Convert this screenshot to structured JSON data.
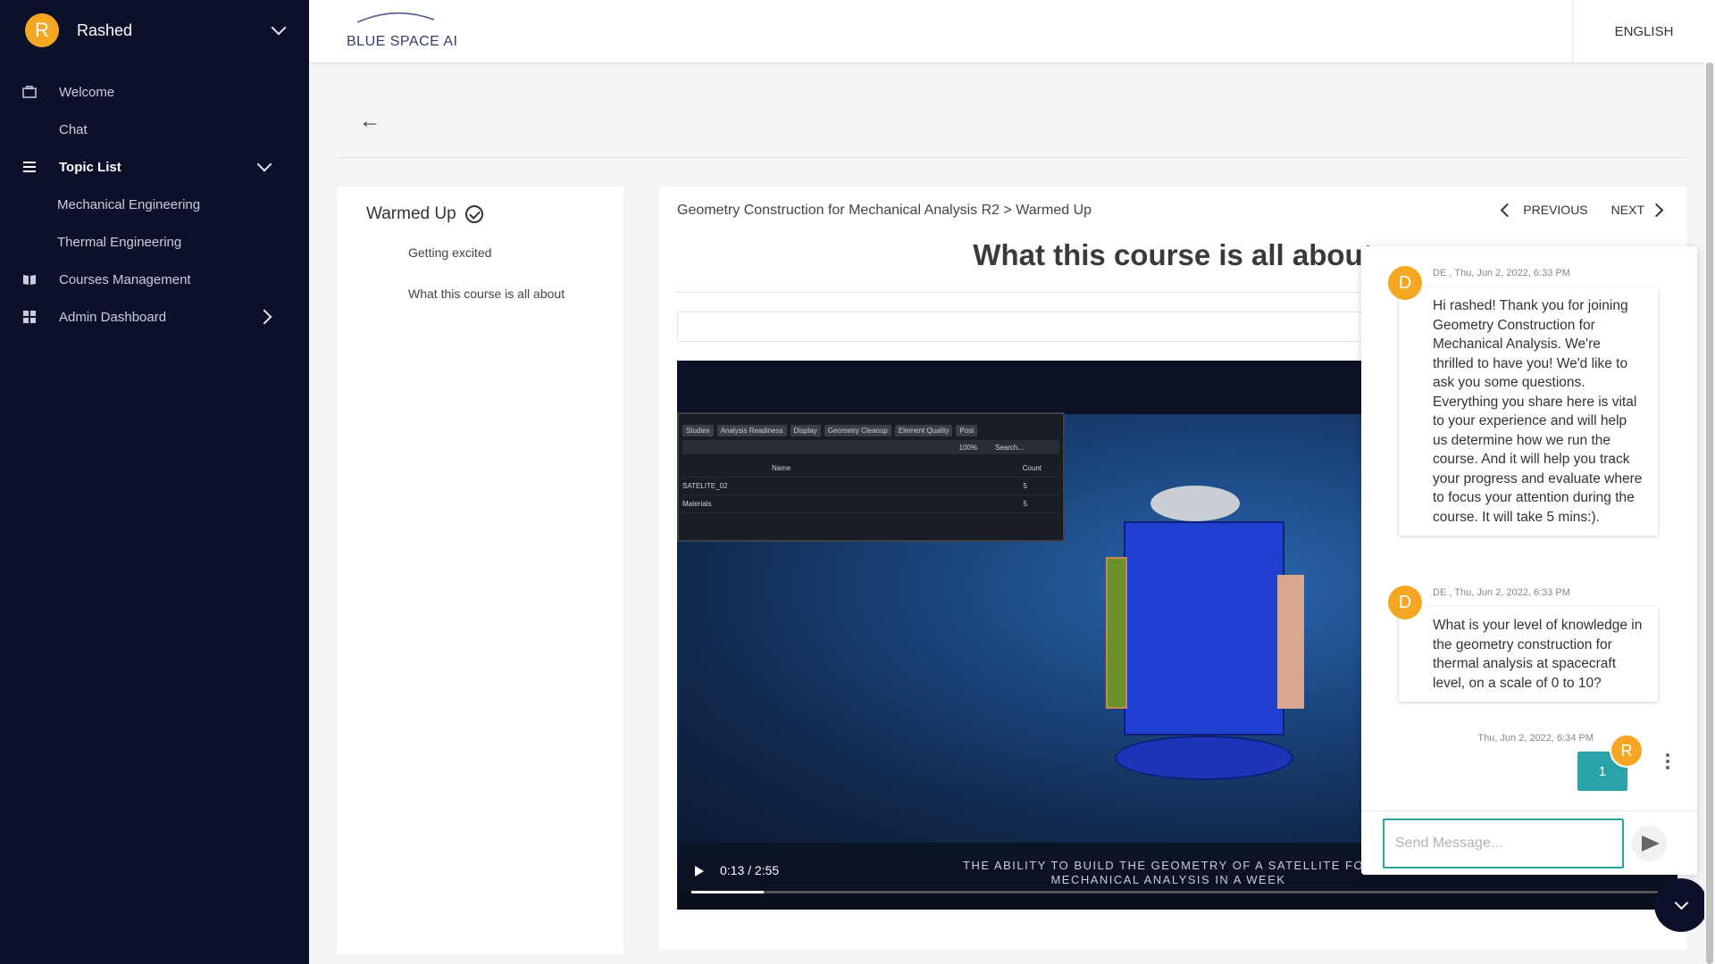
{
  "sidebar": {
    "user": {
      "initial": "R",
      "name": "Rashed"
    },
    "items": [
      {
        "label": "Welcome",
        "icon": "briefcase-icon"
      },
      {
        "label": "Chat"
      },
      {
        "label": "Topic List",
        "icon": "menu-icon"
      },
      {
        "label": "Mechanical Engineering"
      },
      {
        "label": "Thermal Engineering"
      },
      {
        "label": "Courses Management",
        "icon": "book-icon"
      },
      {
        "label": "Admin Dashboard",
        "icon": "dashboard-icon"
      }
    ]
  },
  "header": {
    "logo_text": "BLUE SPACE AI",
    "language": "ENGLISH"
  },
  "topic": {
    "title": "Warmed Up",
    "lessons": [
      "Getting excited",
      "What this course is all about"
    ]
  },
  "content": {
    "breadcrumb": "Geometry Construction for Mechanical Analysis R2 > Warmed Up",
    "previous": "PREVIOUS",
    "next": "NEXT",
    "title": "What this course is all about"
  },
  "video": {
    "tabs": [
      "Studies",
      "Analysis Readiness",
      "Display",
      "Geometry Cleanup",
      "Element Quality",
      "Post"
    ],
    "grid": {
      "header_name": "Name",
      "header_count": "Count",
      "rows": [
        {
          "name": "SATELITE_02",
          "count": "5"
        },
        {
          "name": "Materials",
          "count": "5"
        }
      ],
      "zoom": "100%",
      "search": "Search..."
    },
    "time": "0:13 / 2:55",
    "progress": 0.074,
    "caption": "THE ABILITY TO BUILD THE GEOMETRY OF A SATELLITE FOR MECHANICAL ANALYSIS IN A WEEK"
  },
  "chat": {
    "messages": [
      {
        "sender_initial": "D",
        "meta": "DE , Thu, Jun 2, 2022, 6:33 PM",
        "text": "Hi rashed! Thank you for joining Geometry Construction for Mechanical Analysis. We're thrilled to have you! We'd like to ask you some questions. Everything you share here is vital to your experience and will help us determine how we run the course. And it will help you track your progress and evaluate where to focus your attention during the course. It will take 5 mins:)."
      },
      {
        "sender_initial": "D",
        "meta": "DE , Thu, Jun 2, 2022, 6:33 PM",
        "text": "What is your level of knowledge in the geometry construction for thermal analysis at spacecraft level, on a scale of 0 to 10?"
      }
    ],
    "reply": {
      "initial": "R",
      "meta": "Thu, Jun 2, 2022, 6:34 PM",
      "text": "1"
    },
    "input_placeholder": "Send Message..."
  },
  "colors": {
    "sidebar_bg": "#0a1129",
    "accent": "#f5a623",
    "teal": "#2aa3a8"
  }
}
